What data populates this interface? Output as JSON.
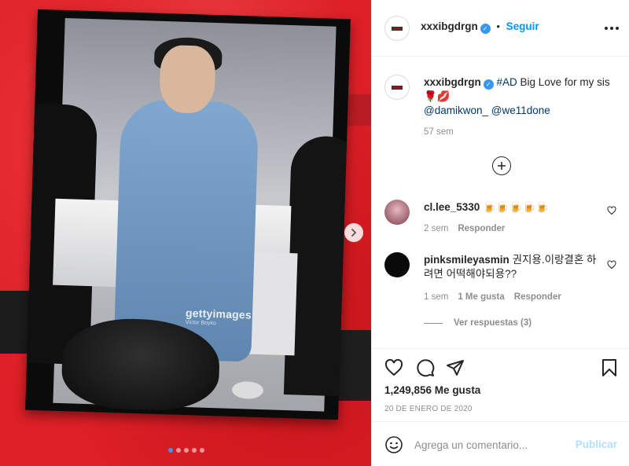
{
  "post": {
    "username": "xxxibgdrgn",
    "follow_label": "Seguir",
    "separator": "•",
    "caption": {
      "hashtag": "#AD",
      "text": " Big Love for my sis 🌹💋",
      "mention_1": "@damikwon_",
      "mention_2": "@we11done",
      "time": "57 sem"
    },
    "media": {
      "watermark": "gettyimages",
      "watermark_credit": "Victor Boyko",
      "slide_count": 5,
      "active_slide": 0
    },
    "likes": "1,249,856 Me gusta",
    "date": "20 DE ENERO DE 2020"
  },
  "comments": [
    {
      "username": "cl.lee_5330",
      "text": "🍺🍺🍺🍺🍺",
      "time": "2 sem",
      "reply_label": "Responder",
      "likes_label": ""
    },
    {
      "username": "pinksmileyasmin",
      "text": "권지용.이랑결혼 하려면 어떡해야되용??",
      "time": "1 sem",
      "likes_label": "1 Me gusta",
      "reply_label": "Responder"
    }
  ],
  "replies_label": "Ver respuestas (3)",
  "add_comment": {
    "placeholder": "Agrega un comentario...",
    "publish_label": "Publicar"
  },
  "icons": {
    "verified": "verified-badge-icon",
    "more": "more-options-icon",
    "load_more": "plus-circle-icon",
    "like": "heart-icon",
    "comment": "comment-bubble-icon",
    "share": "paper-plane-icon",
    "save": "bookmark-icon",
    "emoji": "smiley-icon",
    "next": "chevron-right-icon"
  },
  "colors": {
    "accent": "#0095f6",
    "publish_disabled": "#b2dffc",
    "muted": "#8e8e8e",
    "hashtag": "#00376b"
  }
}
